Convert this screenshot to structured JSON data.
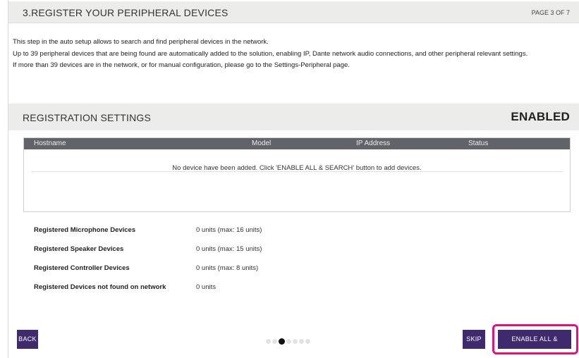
{
  "header": {
    "title": "3.REGISTER YOUR PERIPHERAL DEVICES",
    "page_indicator": "PAGE 3 OF 7"
  },
  "intro": {
    "line1": "This step in the auto setup allows to search and find peripheral devices in the network.",
    "line2": " Up to 39 peripheral devices that are being found are automatically added to the solution, enabling IP, Dante network audio connections, and other peripheral relevant settings.",
    "line3": " If more than 39 devices are in the network, or for manual configuration, please go to the Settings-Peripheral page."
  },
  "registration": {
    "title": "REGISTRATION SETTINGS",
    "state": "ENABLED"
  },
  "table": {
    "columns": [
      "Hostname",
      "Model",
      "IP Address",
      "Status"
    ],
    "empty_message": "No device have been added. Click 'ENABLE ALL & SEARCH' button to add devices."
  },
  "stats": [
    {
      "label": "Registered Microphone Devices",
      "value": "0 units (max: 16 units)"
    },
    {
      "label": "Registered Speaker Devices",
      "value": "0 units (max: 15 units)"
    },
    {
      "label": "Registered Controller Devices",
      "value": "0 units (max: 8 units)"
    },
    {
      "label": "Registered Devices not found on network",
      "value": "0 units"
    }
  ],
  "footer": {
    "back_label": "BACK",
    "skip_label": "SKIP",
    "enable_label": "ENABLE ALL & SEARCH",
    "total_pages": 7,
    "current_page": 3
  },
  "colors": {
    "button": "#3f2a6e",
    "highlight": "#d8167e",
    "table_header": "#606368",
    "section_bar": "#ececea"
  }
}
